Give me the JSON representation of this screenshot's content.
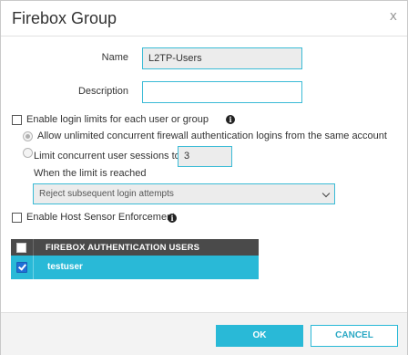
{
  "dialog": {
    "title": "Firebox Group",
    "close_label": "x"
  },
  "form": {
    "name_label": "Name",
    "name_value": "L2TP-Users",
    "description_label": "Description",
    "description_value": "",
    "enable_login_limits_label": "Enable login limits for each user or group",
    "enable_login_limits_checked": false,
    "allow_unlimited_label": "Allow unlimited concurrent firewall authentication logins from the same account",
    "allow_unlimited_selected": true,
    "limit_sessions_label": "Limit concurrent user sessions to",
    "limit_sessions_value": "3",
    "limit_reached_label": "When the limit is reached",
    "limit_action_value": "Reject subsequent login attempts",
    "host_sensor_label": "Enable Host Sensor Enforcement",
    "host_sensor_checked": false,
    "info_icon_glyph": "i"
  },
  "users_table": {
    "header": "FIREBOX AUTHENTICATION USERS",
    "rows": [
      {
        "name": "testuser",
        "checked": true
      }
    ],
    "header_color": "#4a4a4a",
    "selected_row_color": "#29b9d7"
  },
  "footer": {
    "ok_label": "OK",
    "cancel_label": "CANCEL",
    "accent_color": "#29b9d7"
  }
}
